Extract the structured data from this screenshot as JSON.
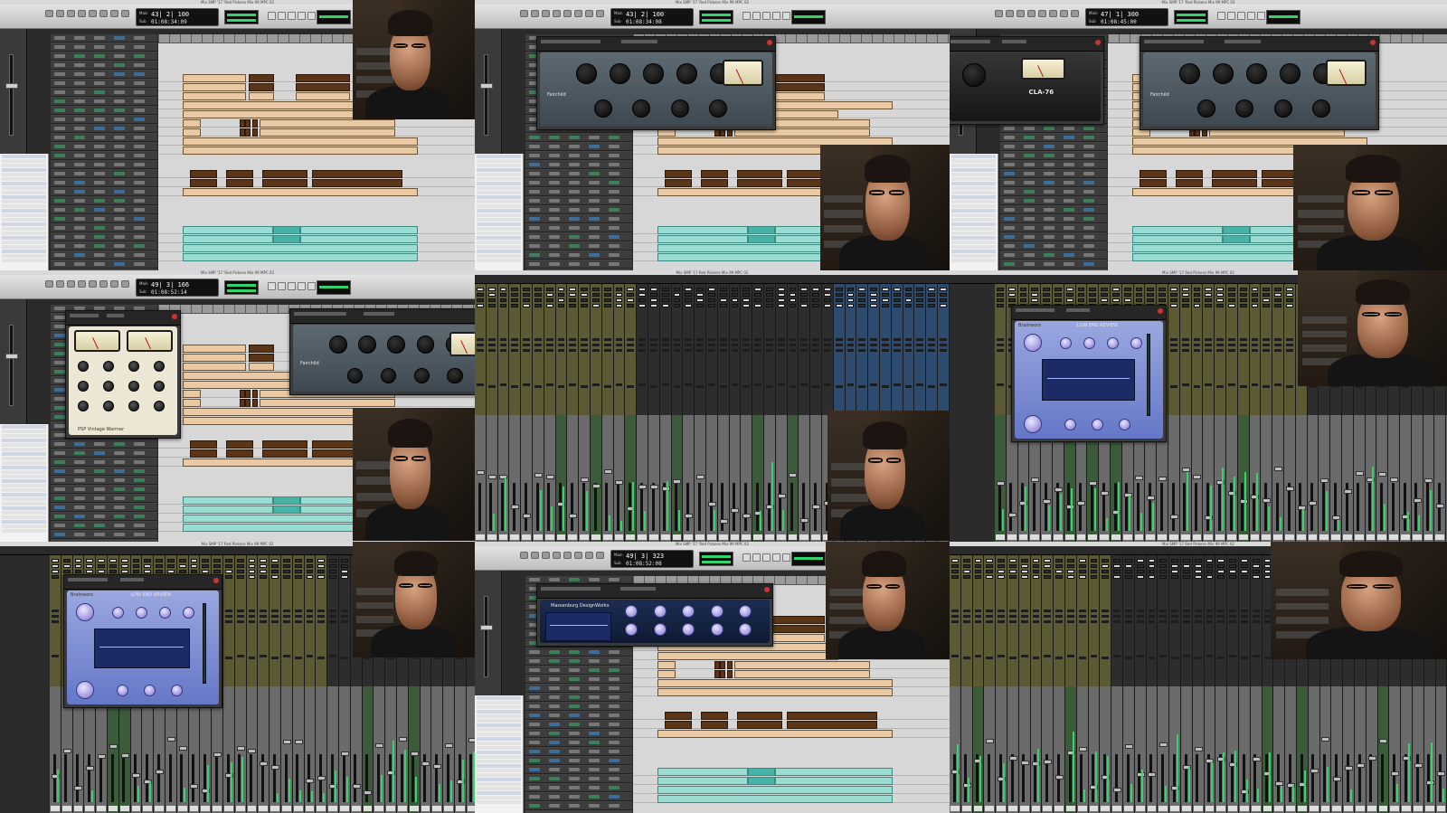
{
  "layout": "3x3 tutorial video contact sheet",
  "titles": {
    "edit": "Mix SMP '17 'Red Pickens Mix 99 MPC 02",
    "mixer": "Mix SMP '17 Red Pickens Mix 99 MPC 02"
  },
  "counters": [
    {
      "main": "43| 2| 100",
      "sub": "01:08:34:09"
    },
    {
      "main": "43| 2| 100",
      "sub": "01:08:34:08"
    },
    {
      "main": "47| 1| 300",
      "sub": "01:08:45:00"
    },
    {
      "main": "49| 3| 166",
      "sub": "01:08:52:14"
    },
    {
      "main": "49| 3| 323",
      "sub": "01:08:52:08"
    }
  ],
  "counter_labels": {
    "main": "Main",
    "sub": "Sub"
  },
  "plugins": {
    "fairchild": "Fairchild",
    "cla76": "CLA-76",
    "vintage_warmer": "PSP Vintage Warmer",
    "lowend": "LOW END REVIEW",
    "lowend_brand": "Brainworx",
    "massenburg": "Massenburg DesignWorks"
  },
  "icons": [
    "record-icon",
    "play-icon",
    "stop-icon",
    "rewind-icon",
    "forward-icon",
    "close-icon"
  ],
  "colors": {
    "clip": "#e8c9a3",
    "clip_dark": "#5a3518",
    "clip_teal": "#9adbd2",
    "strip_olive": "#5c5a35",
    "strip_blue": "#2c4b6e",
    "meter": "#38d36a",
    "bx_panel": "#7d8ed6"
  }
}
